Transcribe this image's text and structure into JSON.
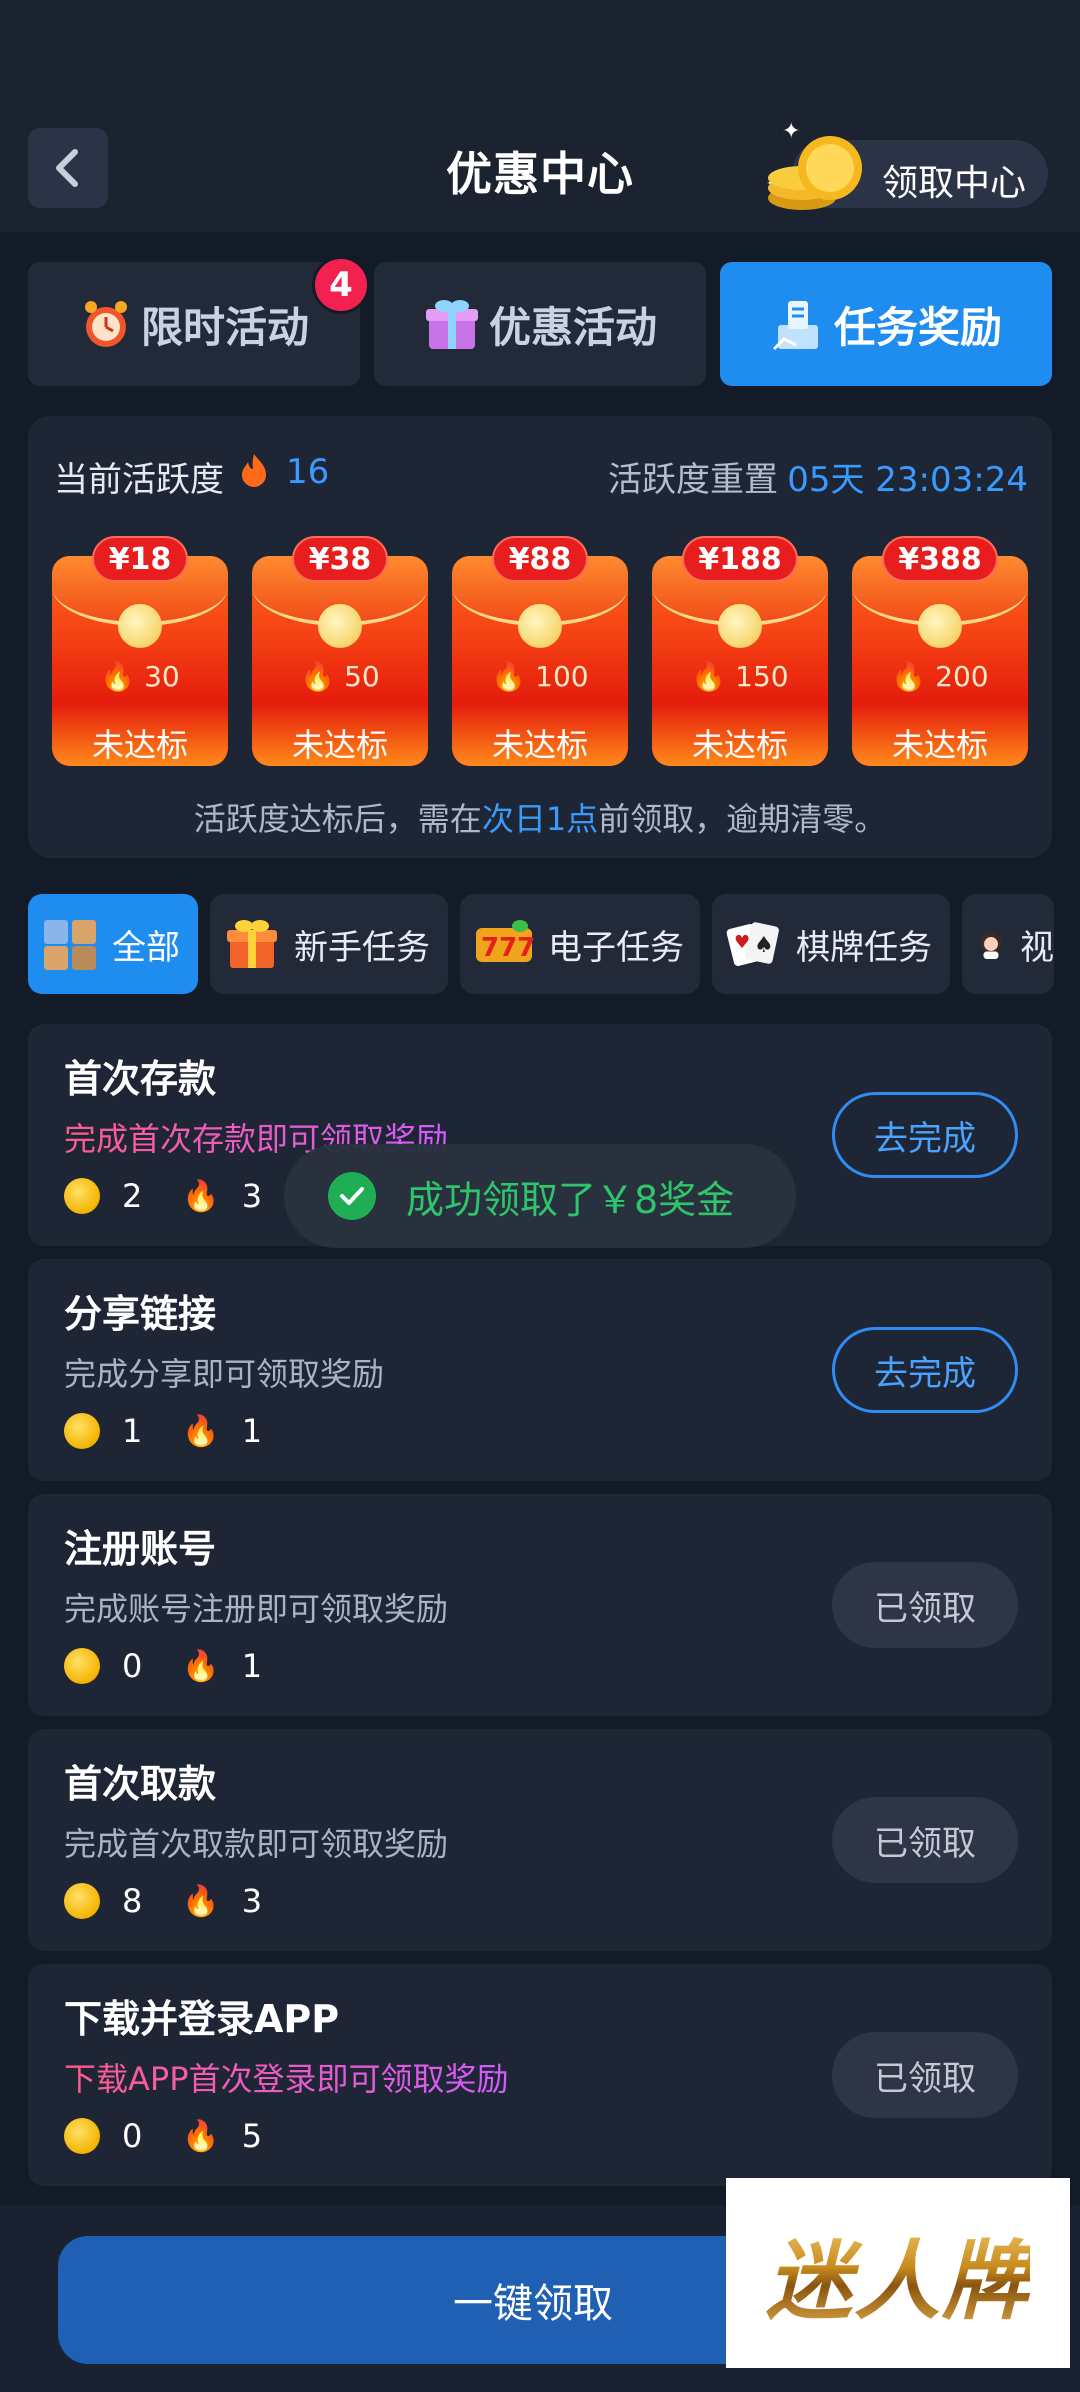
{
  "header": {
    "title": "优惠中心",
    "claim_center_label": "领取中心"
  },
  "top_tabs": [
    {
      "label": "限时活动",
      "badge": "4",
      "active": false
    },
    {
      "label": "优惠活动",
      "active": false
    },
    {
      "label": "任务奖励",
      "active": true
    }
  ],
  "activity": {
    "label": "当前活跃度",
    "value": "16",
    "reset_label": "活跃度重置",
    "reset_time": "05天 23:03:24",
    "envelopes": [
      {
        "price": "¥18",
        "need": "30",
        "status": "未达标"
      },
      {
        "price": "¥38",
        "need": "50",
        "status": "未达标"
      },
      {
        "price": "¥88",
        "need": "100",
        "status": "未达标"
      },
      {
        "price": "¥188",
        "need": "150",
        "status": "未达标"
      },
      {
        "price": "¥388",
        "need": "200",
        "status": "未达标"
      }
    ],
    "note_prefix": "活跃度达标后，需在",
    "note_highlight": "次日1点",
    "note_suffix": "前领取，逾期清零。"
  },
  "categories": [
    {
      "label": "全部",
      "active": true
    },
    {
      "label": "新手任务"
    },
    {
      "label": "电子任务"
    },
    {
      "label": "棋牌任务"
    },
    {
      "label": "视"
    }
  ],
  "tasks": [
    {
      "title": "首次存款",
      "desc": "完成首次存款即可领取奖励",
      "coins": "2",
      "fire": "3",
      "button": "去完成",
      "state": "todo",
      "desc_style": "pink"
    },
    {
      "title": "分享链接",
      "desc": "完成分享即可领取奖励",
      "coins": "1",
      "fire": "1",
      "button": "去完成",
      "state": "todo",
      "desc_style": "normal"
    },
    {
      "title": "注册账号",
      "desc": "完成账号注册即可领取奖励",
      "coins": "0",
      "fire": "1",
      "button": "已领取",
      "state": "done",
      "desc_style": "normal"
    },
    {
      "title": "首次取款",
      "desc": "完成首次取款即可领取奖励",
      "coins": "8",
      "fire": "3",
      "button": "已领取",
      "state": "done",
      "desc_style": "normal"
    },
    {
      "title": "下载并登录APP",
      "desc": "下载APP首次登录即可领取奖励",
      "coins": "0",
      "fire": "5",
      "button": "已领取",
      "state": "done",
      "desc_style": "pink"
    }
  ],
  "toast": {
    "message": "成功领取了￥8奖金"
  },
  "bottom": {
    "claim_all_label": "一键领取"
  },
  "logo": {
    "text": "迷人牌"
  },
  "colors": {
    "accent": "#1f8cf0",
    "success": "#2ec66a",
    "badge": "#f2214f",
    "background": "#141b28"
  }
}
